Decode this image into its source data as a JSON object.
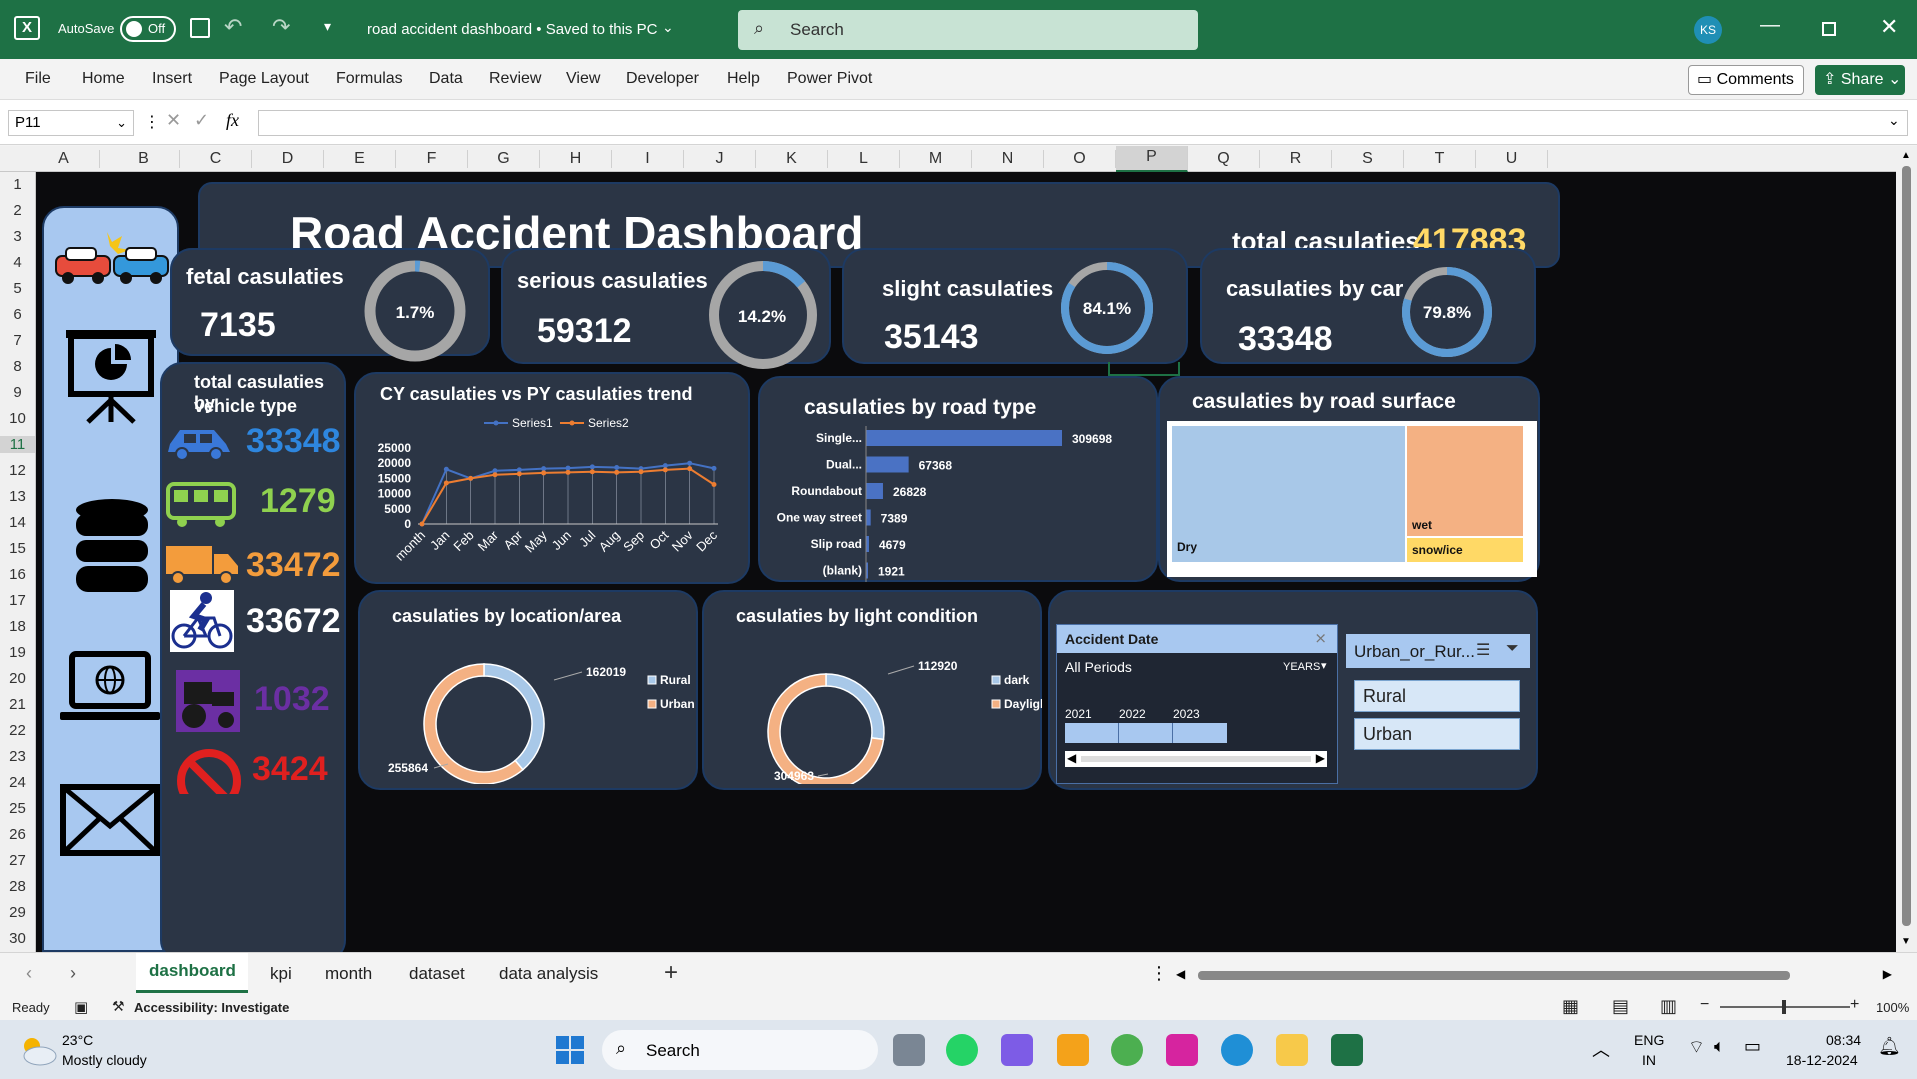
{
  "titlebar": {
    "autosave_label": "AutoSave",
    "autosave_state": "Off",
    "filename": "road accident dashboard • Saved to this PC",
    "search_placeholder": "Search",
    "user_initials": "KS"
  },
  "ribbon": {
    "menu": [
      "File",
      "Home",
      "Insert",
      "Page Layout",
      "Formulas",
      "Data",
      "Review",
      "View",
      "Developer",
      "Help",
      "Power Pivot"
    ],
    "comments": "Comments",
    "share": "Share"
  },
  "formula_bar": {
    "name_box": "P11",
    "fx": "fx",
    "value": ""
  },
  "columns": [
    "A",
    "B",
    "C",
    "D",
    "E",
    "F",
    "G",
    "H",
    "I",
    "J",
    "K",
    "L",
    "M",
    "N",
    "O",
    "P",
    "Q",
    "R",
    "S",
    "T",
    "U"
  ],
  "rows": [
    "1",
    "2",
    "3",
    "4",
    "5",
    "6",
    "7",
    "8",
    "9",
    "10",
    "11",
    "12",
    "13",
    "14",
    "15",
    "16",
    "17",
    "18",
    "19",
    "20",
    "21",
    "22",
    "23",
    "24",
    "25",
    "26",
    "27",
    "28",
    "29",
    "30"
  ],
  "dashboard": {
    "title": "Road Accident Dashboard",
    "total_label": "total casulaties",
    "total_value": "417883",
    "kpis": [
      {
        "title": "fetal casulaties",
        "value": "7135",
        "pct_label": "1.7%",
        "pct": 1.7
      },
      {
        "title": "serious casulaties",
        "value": "59312",
        "pct_label": "14.2%",
        "pct": 14.2
      },
      {
        "title": "slight casulaties",
        "value": "35143",
        "pct_label": "84.1%",
        "pct": 84.1
      },
      {
        "title": "casulaties by car",
        "value": "33348",
        "pct_label": "79.8%",
        "pct": 79.8
      }
    ],
    "vehicle": {
      "title_line1": "total casulaties by",
      "title_line2": "vehicle type",
      "items": [
        {
          "icon": "car-icon",
          "value": "33348",
          "color": "#2e86de"
        },
        {
          "icon": "bus-icon",
          "value": "1279",
          "color": "#8fd14f"
        },
        {
          "icon": "truck-icon",
          "value": "33472",
          "color": "#f39c3c"
        },
        {
          "icon": "bicycle-icon",
          "value": "33672",
          "color": "#ffffff"
        },
        {
          "icon": "tractor-icon",
          "value": "1032",
          "color": "#6b2fa3"
        },
        {
          "icon": "no-entry-icon",
          "value": "3424",
          "color": "#e0201f"
        }
      ]
    },
    "trend": {
      "title": "CY casulaties vs PY casulaties trend"
    },
    "road_type": {
      "title": "casulaties by road type"
    },
    "road_surface": {
      "title": "casulaties by road surface"
    },
    "location": {
      "title": "casulaties by location/area"
    },
    "light": {
      "title": "casulaties by light condition"
    },
    "date_slicer": {
      "title": "Accident Date",
      "period": "All Periods",
      "unit": "YEARS",
      "years": [
        "2021",
        "2022",
        "2023"
      ]
    },
    "area_slicer": {
      "title": "Urban_or_Rur...",
      "options": [
        "Rural",
        "Urban"
      ]
    }
  },
  "chart_data": [
    {
      "type": "line",
      "categories": [
        "month",
        "Jan",
        "Feb",
        "Mar",
        "Apr",
        "May",
        "Jun",
        "Jul",
        "Aug",
        "Sep",
        "Oct",
        "Nov",
        "Dec"
      ],
      "series": [
        {
          "name": "Series1",
          "values": [
            0,
            18000,
            15000,
            17500,
            17800,
            18200,
            18400,
            18800,
            18600,
            18200,
            19200,
            20000,
            18300
          ],
          "color": "#4472c4"
        },
        {
          "name": "Series2",
          "values": [
            0,
            13500,
            15000,
            16200,
            16500,
            16800,
            17000,
            17200,
            17000,
            17200,
            17800,
            18200,
            13000
          ],
          "color": "#ed7d31"
        }
      ],
      "title": "CY casulaties vs PY casulaties trend",
      "yticks": [
        "25000",
        "20000",
        "15000",
        "10000",
        "5000",
        "0"
      ],
      "ylim": [
        0,
        25000
      ],
      "legend": "top"
    },
    {
      "type": "bar",
      "orientation": "horizontal",
      "categories": [
        "Single...",
        "Dual...",
        "Roundabout",
        "One way street",
        "Slip road",
        "(blank)"
      ],
      "values": [
        309698,
        67368,
        26828,
        7389,
        4679,
        1921
      ],
      "labels": [
        "309698",
        "67368",
        "26828",
        "7389",
        "4679",
        "1921"
      ],
      "title": "casulaties by road type",
      "color": "#4a72c4"
    },
    {
      "type": "treemap",
      "categories": [
        "Dry",
        "wet",
        "snow/ice"
      ],
      "colors": [
        "#a8c8e8",
        "#f4b183",
        "#ffd966"
      ],
      "title": "casulaties by road surface"
    },
    {
      "type": "pie",
      "variant": "donut",
      "categories": [
        "Rural",
        "Urban"
      ],
      "values": [
        162019,
        255864
      ],
      "labels": [
        "162019",
        "255864"
      ],
      "colors": [
        "#a8c8e8",
        "#f4b183"
      ],
      "title": "casulaties by location/area",
      "legend": "right"
    },
    {
      "type": "pie",
      "variant": "donut",
      "categories": [
        "dark",
        "Daylight"
      ],
      "values": [
        112920,
        304963
      ],
      "labels": [
        "112920",
        "304963"
      ],
      "colors": [
        "#a8c8e8",
        "#f4b183"
      ],
      "title": "casulaties by light condition",
      "legend": "right"
    }
  ],
  "sheet_tabs": [
    "dashboard",
    "kpi",
    "month",
    "dataset",
    "data analysis"
  ],
  "status": {
    "ready": "Ready",
    "accessibility": "Accessibility: Investigate",
    "zoom": "100%"
  },
  "taskbar": {
    "weather_temp": "23°C",
    "weather_desc": "Mostly cloudy",
    "search": "Search",
    "lang1": "ENG",
    "lang2": "IN",
    "time": "08:34",
    "date": "18-12-2024"
  }
}
